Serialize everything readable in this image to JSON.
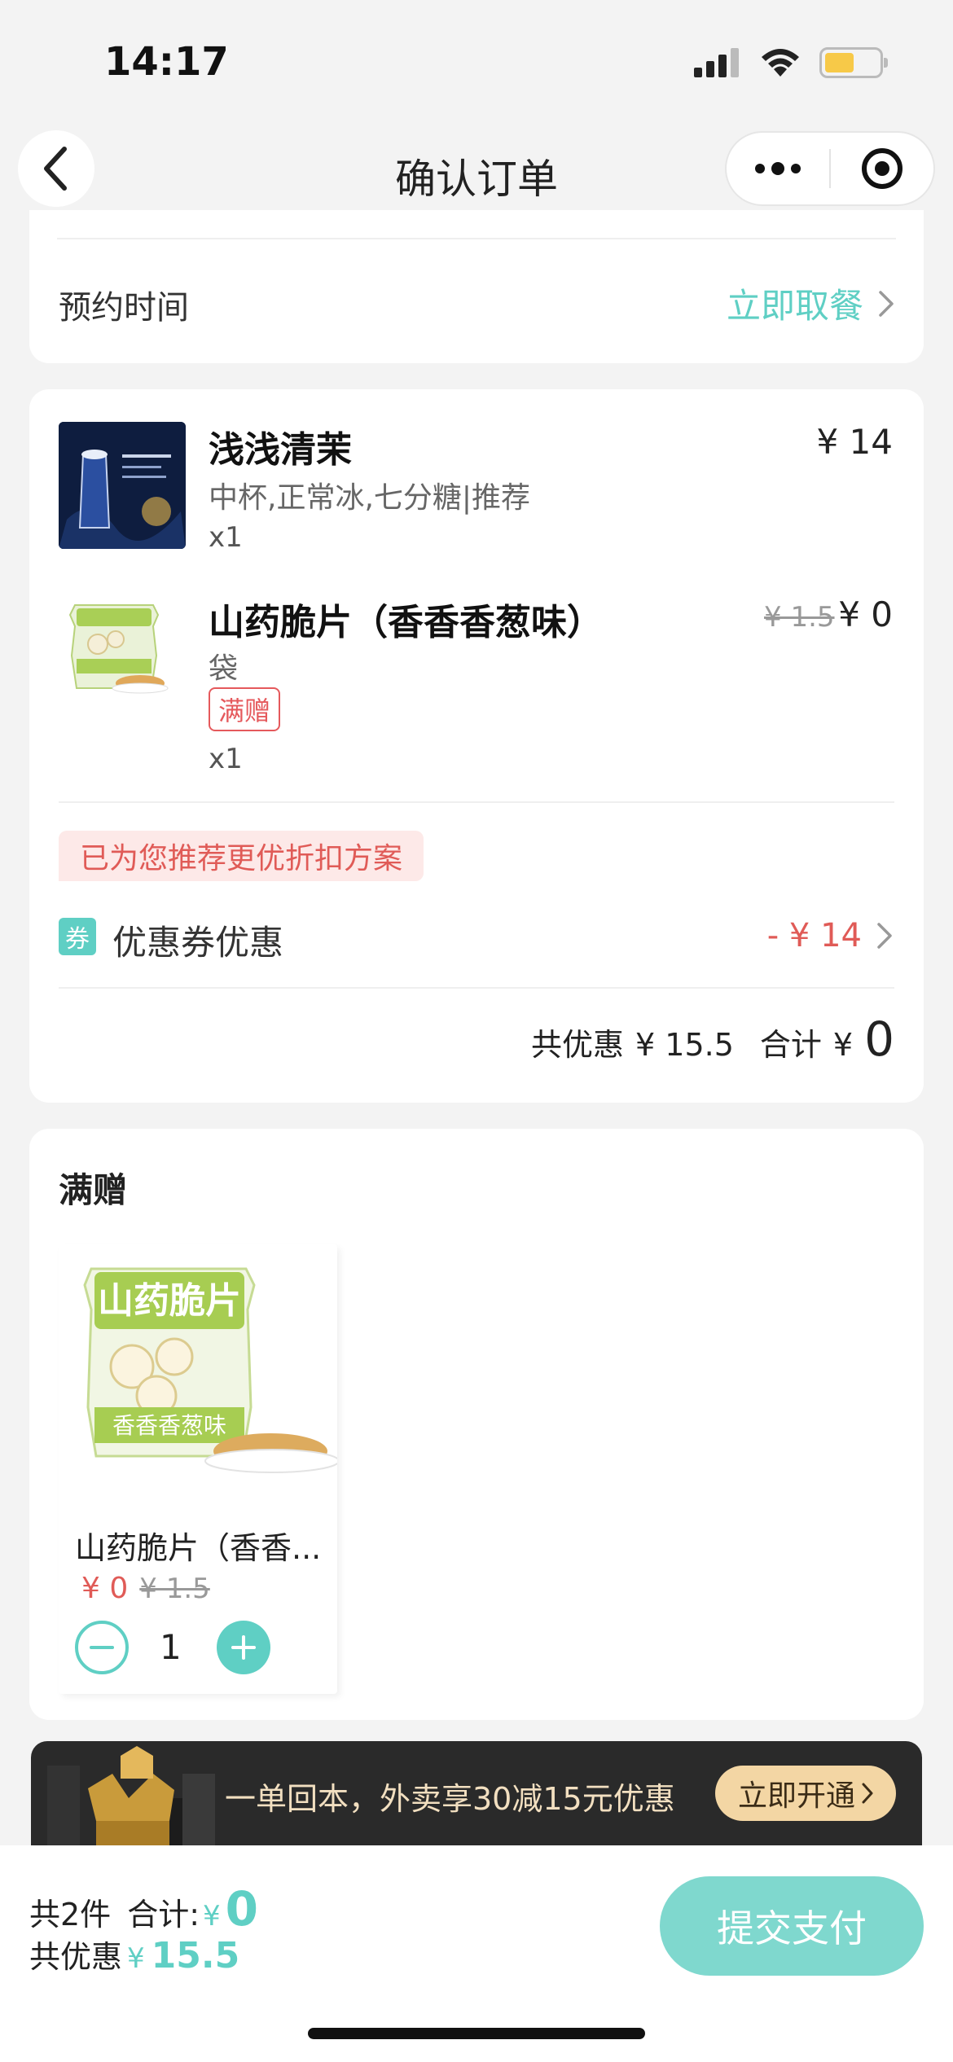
{
  "status_bar": {
    "time": "14:17",
    "battery_level": 0.55
  },
  "nav": {
    "title": "确认订单",
    "icons": [
      "back-icon",
      "more-icon",
      "target-icon"
    ]
  },
  "reserve": {
    "label": "预约时间",
    "value": "立即取餐"
  },
  "items": [
    {
      "name": "浅浅清茉",
      "spec": "中杯,正常冰,七分糖|推荐",
      "qty": "x1",
      "price": "¥ 14"
    },
    {
      "name": "山药脆片（香香香葱味）",
      "spec": "袋",
      "tag": "满赠",
      "qty": "x1",
      "old_price": "¥ 1.5",
      "price": "¥ 0"
    }
  ],
  "promo_tip": "已为您推荐更优折扣方案",
  "coupon": {
    "icon": "券",
    "label": "优惠券优惠",
    "value": "- ¥ 14"
  },
  "summary": {
    "discount_label": "共优惠",
    "discount_value": "¥ 15.5",
    "total_label": "合计",
    "currency": "¥",
    "total_value": "0"
  },
  "gift": {
    "section_title": "满赠",
    "name": "山药脆片（香香...",
    "price": "¥ 0",
    "old_price": "¥ 1.5",
    "quantity": "1",
    "package_text": "山药脆片",
    "package_flavor": "香香香葱味"
  },
  "banner": {
    "text": "一单回本，外卖享30减15元优惠",
    "button": "立即开通"
  },
  "bottom": {
    "count_label": "共2件",
    "total_label": "合计:",
    "currency": "¥",
    "total_value": "0",
    "discount_label": "共优惠",
    "discount_value": "15.5",
    "pay_button": "提交支付"
  },
  "colors": {
    "accent": "#5fcfc4",
    "price_red": "#e05b57",
    "background": "#f3f3f3"
  }
}
